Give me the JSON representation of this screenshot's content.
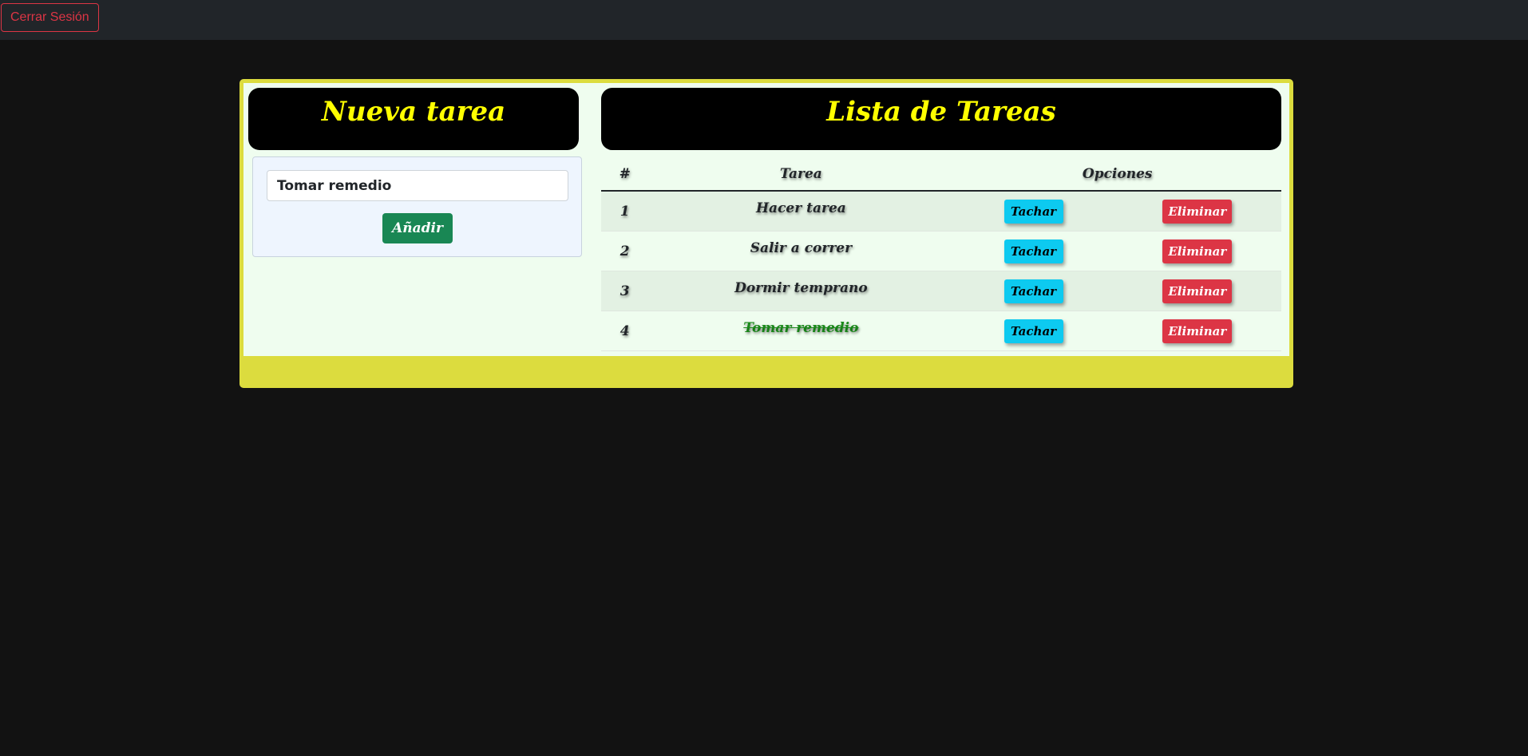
{
  "header": {
    "logout_label": "Cerrar Sesión"
  },
  "new_task": {
    "title": "Nueva tarea",
    "input_value": "Tomar remedio",
    "add_label": "Añadir"
  },
  "task_list": {
    "title": "Lista de Tareas",
    "columns": {
      "number": "#",
      "task": "Tarea",
      "options": "Opciones"
    },
    "strike_label": "Tachar",
    "delete_label": "Eliminar",
    "rows": [
      {
        "number": "1",
        "task": "Hacer tarea",
        "done": false
      },
      {
        "number": "2",
        "task": "Salir a correr",
        "done": false
      },
      {
        "number": "3",
        "task": "Dormir temprano",
        "done": false
      },
      {
        "number": "4",
        "task": "Tomar remedio",
        "done": true
      }
    ]
  },
  "colors": {
    "title_text": "#ffff00",
    "container_border": "#dcdc3e",
    "strike_button": "#0dcaf0",
    "delete_button": "#dc3545",
    "add_button": "#198754",
    "done_text": "#1a8a1a"
  }
}
